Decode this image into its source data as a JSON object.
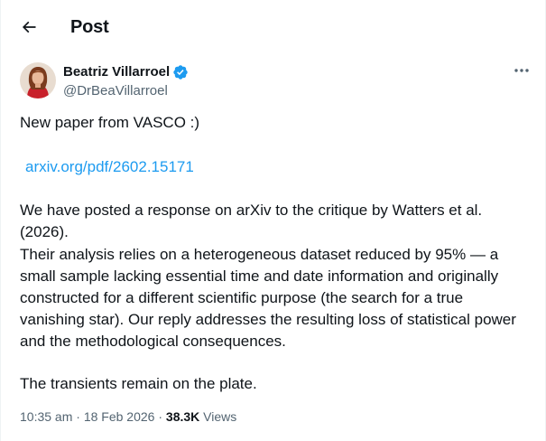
{
  "header": {
    "title": "Post"
  },
  "author": {
    "name": "Beatriz Villarroel",
    "handle": "@DrBeaVillarroel"
  },
  "post": {
    "paragraph_1": "New paper from VASCO :)",
    "link": "arxiv.org/pdf/2602.15171",
    "paragraph_3": "We have posted a response on arXiv to the critique by Watters et al. (2026).",
    "paragraph_4": "Their analysis relies on a heterogeneous dataset reduced by 95% — a small sample lacking essential time and date information and originally constructed for a different scientific purpose (the search for a true vanishing star). Our reply addresses the resulting loss of statistical power and the methodological consequences.",
    "paragraph_5": "The transients remain on the plate."
  },
  "meta": {
    "time": "10:35 am",
    "separator_1": " · ",
    "date": "18 Feb 2026",
    "separator_2": " · ",
    "views_count": "38.3K",
    "views_label": " Views"
  },
  "colors": {
    "link": "#1d9bf0",
    "verified": "#1d9bf0",
    "muted": "#536471",
    "text": "#0f1419"
  },
  "icons": {
    "back": "arrow-left-icon",
    "verified": "verified-badge-icon",
    "more": "more-horizontal-icon"
  }
}
